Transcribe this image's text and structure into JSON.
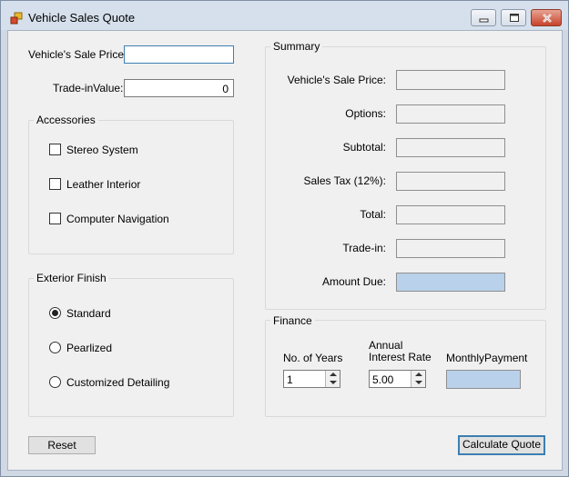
{
  "window": {
    "title": "Vehicle Sales Quote",
    "icon": "app-icon"
  },
  "caption_buttons": {
    "minimize": "minimize-icon",
    "maximize": "maximize-icon",
    "close": "close-icon"
  },
  "input": {
    "sale_price_label": "Vehicle's Sale Price:",
    "sale_price_value": "",
    "tradein_label": "Trade-inValue:",
    "tradein_value": "0"
  },
  "accessories": {
    "title": "Accessories",
    "items": [
      {
        "label": "Stereo System",
        "checked": false
      },
      {
        "label": "Leather Interior",
        "checked": false
      },
      {
        "label": "Computer Navigation",
        "checked": false
      }
    ]
  },
  "exterior": {
    "title": "Exterior Finish",
    "options": [
      {
        "label": "Standard",
        "selected": true
      },
      {
        "label": "Pearlized",
        "selected": false
      },
      {
        "label": "Customized Detailing",
        "selected": false
      }
    ]
  },
  "summary": {
    "title": "Summary",
    "rows": [
      {
        "label": "Vehicle's Sale Price:",
        "value": ""
      },
      {
        "label": "Options:",
        "value": ""
      },
      {
        "label": "Subtotal:",
        "value": ""
      },
      {
        "label": "Sales Tax (12%):",
        "value": ""
      },
      {
        "label": "Total:",
        "value": ""
      },
      {
        "label": "Trade-in:",
        "value": ""
      },
      {
        "label": "Amount Due:",
        "value": ""
      }
    ]
  },
  "finance": {
    "title": "Finance",
    "years_label": "No. of Years",
    "years_value": "1",
    "rate_label_line1": "Annual",
    "rate_label_line2": "Interest Rate",
    "rate_value": "5.00",
    "payment_label": "MonthlyPayment",
    "payment_value": ""
  },
  "buttons": {
    "reset": "Reset",
    "calculate": "Calculate Quote"
  },
  "colors": {
    "highlight_output": "#b9d1ea",
    "focus_border": "#3c7fb1"
  }
}
